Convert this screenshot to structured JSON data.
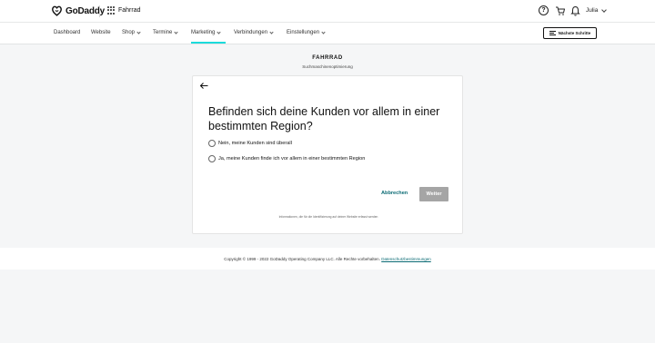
{
  "header": {
    "logo_text": "GoDaddy",
    "site_name": "Fahrrad",
    "help_symbol": "?",
    "user_name": "Julia",
    "icons": [
      "godaddy-logo",
      "apps-grid-icon",
      "help-icon",
      "cart-icon",
      "bell-icon",
      "chevron-down-icon"
    ]
  },
  "nav": {
    "items": [
      {
        "label": "Dashboard"
      },
      {
        "label": "Website"
      },
      {
        "label": "Shop"
      },
      {
        "label": "Termine"
      },
      {
        "label": "Marketing"
      },
      {
        "label": "Verbindungen"
      },
      {
        "label": "Einstellungen"
      }
    ],
    "active": "Marketing",
    "next_steps_label": "Nächste Schritte",
    "accent_color": "#1bdbdb"
  },
  "page": {
    "title": "FAHRRAD",
    "subtitle": "Suchmaschinenoptimierung"
  },
  "card": {
    "question": "Befinden sich deine Kunden vor allem in einer bestimmten Region?",
    "options": [
      {
        "label": "Nein, meine Kunden sind überall",
        "selected": false
      },
      {
        "label": "Ja, meine Kunden finde ich vor allem in einer bestimmten Region",
        "selected": false
      }
    ],
    "cancel_label": "Abbrechen",
    "continue_label": "Weiter",
    "info_text": "Informationen, die für die Identifizierung auf deiner Website erfasst werden"
  },
  "footer": {
    "copyright": "Copyright © 1999 - 2022 GoDaddy Operating Company LLC. Alle Rechte vorbehalten.",
    "link_label": "Datenschutzbestimmungen"
  }
}
